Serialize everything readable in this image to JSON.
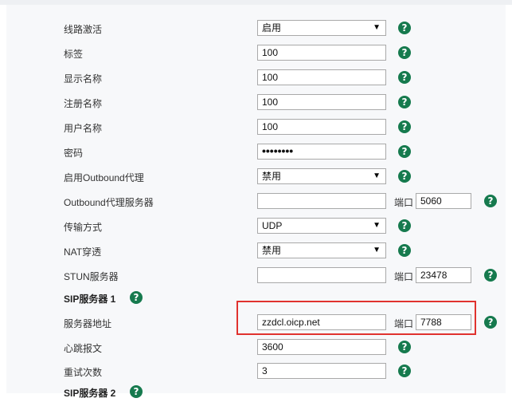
{
  "help_glyph": "?",
  "colors": {
    "help": "#167a4e",
    "highlight": "#e0322e"
  },
  "rows": {
    "line_active": {
      "label": "线路激活",
      "value": "启用"
    },
    "tag": {
      "label": "标签",
      "value": "100"
    },
    "display_name": {
      "label": "显示名称",
      "value": "100"
    },
    "register_name": {
      "label": "注册名称",
      "value": "100"
    },
    "user_name": {
      "label": "用户名称",
      "value": "100"
    },
    "password": {
      "label": "密码",
      "value": "••••••••"
    },
    "enable_outbound": {
      "label": "启用Outbound代理",
      "value": "禁用"
    },
    "outbound_server": {
      "label": "Outbound代理服务器",
      "value": "",
      "port_label": "端口",
      "port": "5060"
    },
    "transport": {
      "label": "传输方式",
      "value": "UDP"
    },
    "nat": {
      "label": "NAT穿透",
      "value": "禁用"
    },
    "stun": {
      "label": "STUN服务器",
      "value": "",
      "port_label": "端口",
      "port": "23478"
    },
    "sip1": {
      "label": "SIP服务器 1"
    },
    "server_addr": {
      "label": "服务器地址",
      "value": "zzdcl.oicp.net",
      "port_label": "端口",
      "port": "7788"
    },
    "heartbeat": {
      "label": "心跳报文",
      "value": "3600"
    },
    "retry": {
      "label": "重试次数",
      "value": "3"
    },
    "sip2": {
      "label": "SIP服务器 2"
    }
  }
}
